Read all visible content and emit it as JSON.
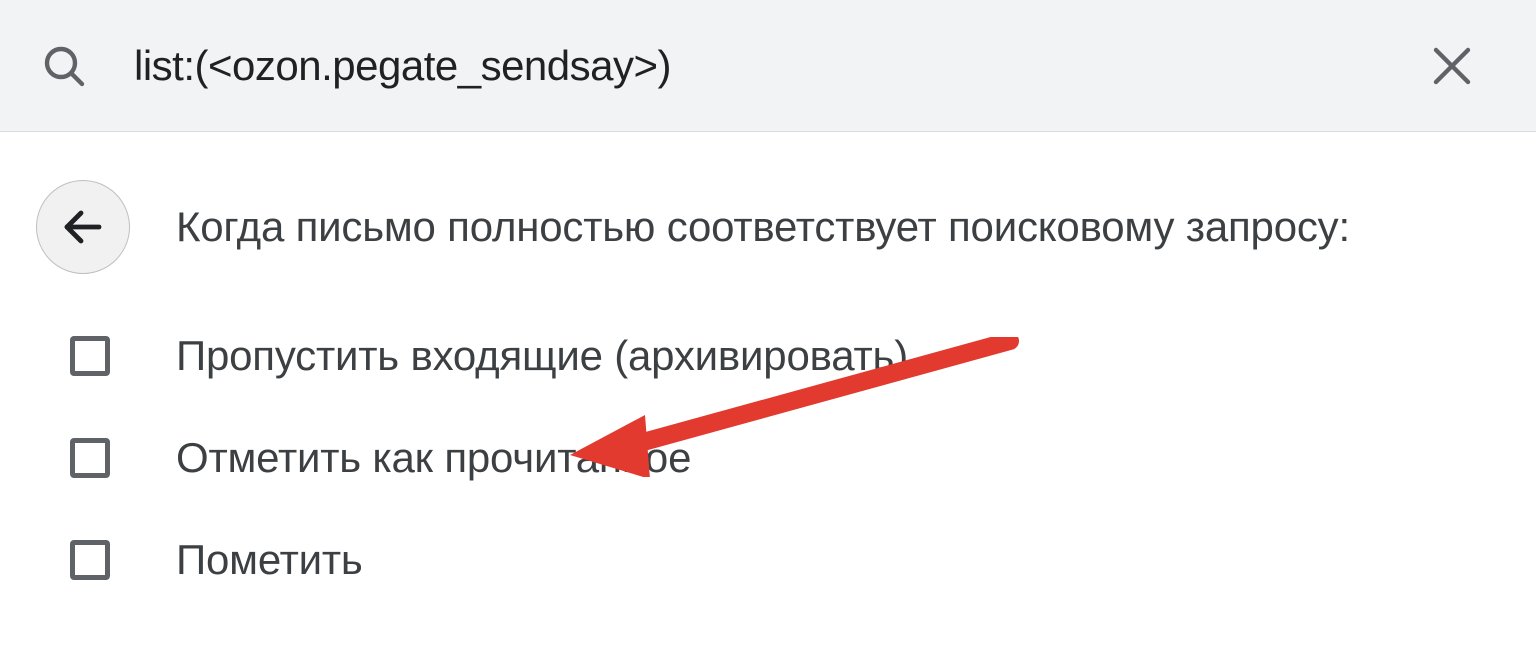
{
  "search": {
    "query": "list:(<ozon.pegate_sendsay>)"
  },
  "heading": "Когда письмо полностью соответствует поисковому запросу:",
  "options": [
    {
      "label": "Пропустить входящие (архивировать)"
    },
    {
      "label": "Отметить как прочитанное"
    },
    {
      "label": "Пометить"
    }
  ],
  "annotation": {
    "arrow_color": "#e23a2e"
  }
}
